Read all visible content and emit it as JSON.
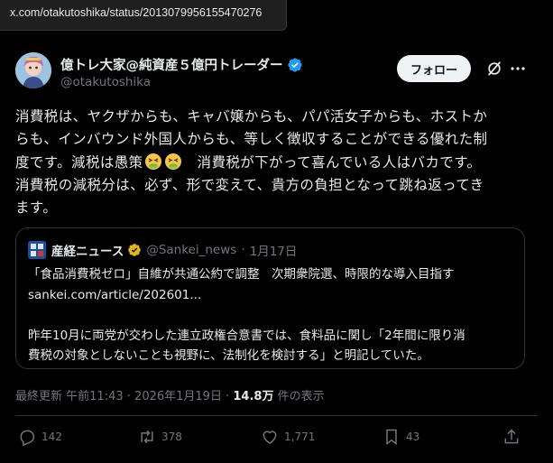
{
  "browser": {
    "status_url": "x.com/otakutoshika/status/2013079956155470276"
  },
  "author": {
    "name": "億トレ大家@純資産５億円トレーダー",
    "handle": "@otakutoshika",
    "follow_label": "フォロー"
  },
  "tweet": {
    "lines": [
      "消費税は、ヤクザからも、キャバ嬢からも、パパ活女子からも、ホストか",
      "らも、インバウンド外国人からも、等しく徴収することができる優れた制",
      "度です。減税は愚策",
      "消費税が下がって喜んでいる人はバカです。",
      "消費税の減税分は、必ず、形で変えて、貴方の負担となって跳ね返ってき",
      "ます。"
    ]
  },
  "quote": {
    "name": "産経ニュース",
    "handle": "@Sankei_news",
    "date": "1月17日",
    "headline": "「食品消費税ゼロ」自維が共通公約で調整　次期衆院選、時限的な導入目指す",
    "link": "sankei.com/article/202601...",
    "body_1": "昨年10月に両党が交わした連立政権合意書では、食料品に関し「2年間に限り消",
    "body_2": "費税の対象としないことも視野に、法制化を検討する」と明記していた。"
  },
  "meta": {
    "updated_label": "最終更新",
    "time": "午前11:43",
    "date": "2026年1月19日",
    "views": "14.8万",
    "views_label": "件の表示"
  },
  "actions": {
    "replies": "142",
    "reposts": "378",
    "likes": "1,771",
    "bookmarks": "43"
  },
  "colors": {
    "background": "#000000",
    "text": "#e7e9ea",
    "secondary": "#71767b",
    "verified_blue": "#1d9bf0",
    "verified_gold": "#e2b719",
    "border": "#2f3336"
  },
  "icons": [
    "verified-badge-icon",
    "grok-icon",
    "more-icon",
    "emoji-tired-face-icon",
    "reply-icon",
    "repost-icon",
    "like-icon",
    "bookmark-icon",
    "share-icon"
  ]
}
